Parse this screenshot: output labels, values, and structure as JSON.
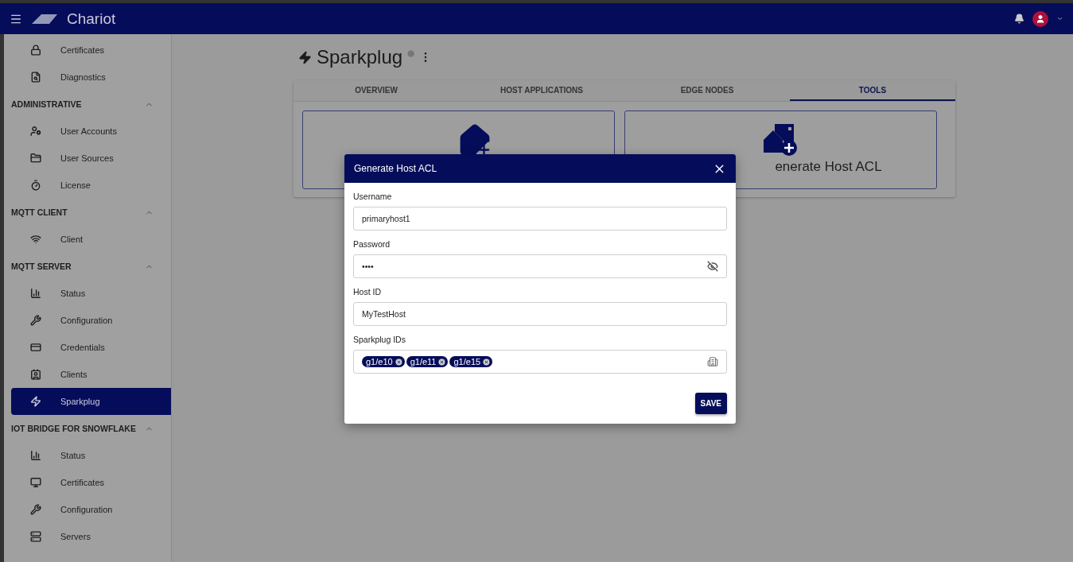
{
  "topbar": {
    "brand": "Chariot"
  },
  "sidebar": {
    "top_items": [
      {
        "label": "Certificates",
        "selected": false
      },
      {
        "label": "Diagnostics",
        "selected": false
      }
    ],
    "sections": [
      {
        "title": "ADMINISTRATIVE",
        "expanded": true,
        "items": [
          {
            "label": "User Accounts",
            "selected": false
          },
          {
            "label": "User Sources",
            "selected": false
          },
          {
            "label": "License",
            "selected": false
          }
        ]
      },
      {
        "title": "MQTT CLIENT",
        "expanded": true,
        "items": [
          {
            "label": "Client",
            "selected": false
          }
        ]
      },
      {
        "title": "MQTT SERVER",
        "expanded": true,
        "items": [
          {
            "label": "Status",
            "selected": false
          },
          {
            "label": "Configuration",
            "selected": false
          },
          {
            "label": "Credentials",
            "selected": false
          },
          {
            "label": "Clients",
            "selected": false
          },
          {
            "label": "Sparkplug",
            "selected": true
          }
        ]
      },
      {
        "title": "IOT BRIDGE FOR SNOWFLAKE",
        "expanded": true,
        "items": [
          {
            "label": "Status",
            "selected": false
          },
          {
            "label": "Certificates",
            "selected": false
          },
          {
            "label": "Configuration",
            "selected": false
          },
          {
            "label": "Servers",
            "selected": false
          }
        ]
      }
    ]
  },
  "page": {
    "title": "Sparkplug",
    "tabs": [
      {
        "label": "OVERVIEW",
        "selected": false
      },
      {
        "label": "HOST APPLICATIONS",
        "selected": false
      },
      {
        "label": "EDGE NODES",
        "selected": false
      },
      {
        "label": "TOOLS",
        "selected": true
      }
    ],
    "cards": [
      {
        "kind": "icon_only"
      },
      {
        "kind": "labeled",
        "label": "enerate Host ACL"
      }
    ]
  },
  "dialog": {
    "title": "Generate Host ACL",
    "fields": [
      {
        "kind": "text",
        "label": "Username",
        "value": "primaryhost1"
      },
      {
        "kind": "password",
        "label": "Password",
        "value": "••••"
      },
      {
        "kind": "text",
        "label": "Host ID",
        "value": "MyTestHost"
      },
      {
        "kind": "chips",
        "label": "Sparkplug IDs",
        "chips": [
          "g1/e10",
          "g1/e11",
          "g1/e15"
        ]
      }
    ],
    "button": "SAVE"
  }
}
